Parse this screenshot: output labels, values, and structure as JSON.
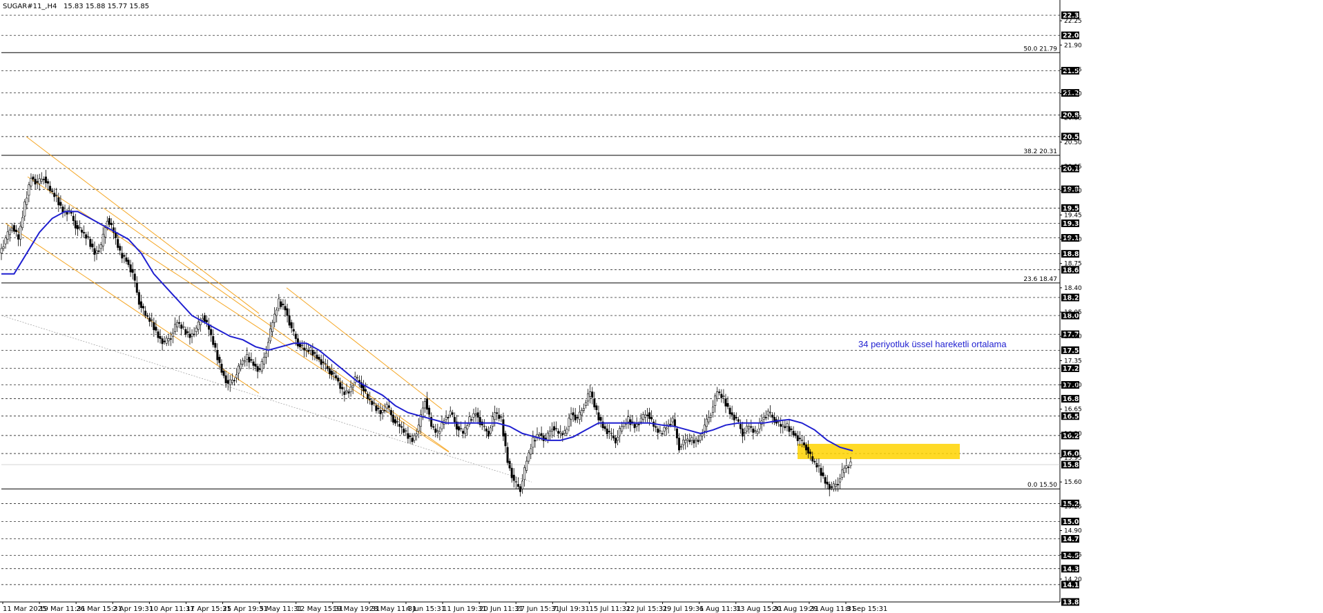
{
  "header": {
    "symbol": "SUGAR#11_,H4",
    "ohlc": "15.83 15.88 15.77 15.85"
  },
  "annotation": "34 periyotluk üssel hareketli ortalama",
  "colors": {
    "background": "#ffffff",
    "ema": "#1f1fd0",
    "channel": "#f5a623",
    "highlight_zone": "#ffd400",
    "level_line": "#000000",
    "price_badge": "#000000"
  },
  "chart_data": {
    "type": "candlestick",
    "title": "SUGAR#11_,H4",
    "ylim": [
      13.87,
      22.45
    ],
    "x_ticks": [
      "11 Mar 2025",
      "19 Mar 11:31",
      "26 Mar 15:31",
      "2 Apr 19:31",
      "10 Apr 11:31",
      "17 Apr 15:31",
      "25 Apr 19:31",
      "5 May 11:31",
      "12 May 15:31",
      "19 May 19:31",
      "28 May 11:31",
      "4 Jun 15:31",
      "11 Jun 19:31",
      "20 Jun 11:31",
      "27 Jun 15:31",
      "7 Jul 19:31",
      "15 Jul 11:31",
      "22 Jul 15:31",
      "29 Jul 19:31",
      "6 Aug 11:31",
      "13 Aug 15:31",
      "20 Aug 19:31",
      "29 Aug 11:31",
      "8 Sep 15:31"
    ],
    "dashed_levels": [
      22.33,
      22.04,
      21.53,
      21.21,
      20.89,
      20.58,
      20.12,
      19.82,
      19.55,
      19.33,
      19.12,
      18.89,
      18.66,
      18.26,
      18.0,
      17.73,
      17.5,
      17.24,
      17.0,
      16.8,
      16.55,
      16.27,
      16.01,
      15.29,
      15.03,
      14.78,
      14.54,
      14.35,
      14.12,
      13.87
    ],
    "axis_ticks": [
      22.25,
      21.9,
      21.55,
      21.2,
      20.85,
      20.5,
      20.15,
      19.8,
      19.45,
      19.1,
      18.75,
      18.4,
      18.05,
      17.7,
      17.35,
      17.0,
      16.65,
      16.3,
      15.95,
      15.6,
      15.25,
      14.9,
      14.55,
      14.2
    ],
    "fibonacci": [
      {
        "label": "50.0 21.79",
        "value": 21.79
      },
      {
        "label": "38.2 20.31",
        "value": 20.31
      },
      {
        "label": "23.6 18.47",
        "value": 18.47
      },
      {
        "label": "0.0 15.50",
        "value": 15.5
      }
    ],
    "current_price": 15.85,
    "highlight_zone": [
      15.93,
      16.15
    ],
    "ohlc_path": [
      [
        0,
        18.9
      ],
      [
        6,
        19.1
      ],
      [
        12,
        19.3
      ],
      [
        18,
        19.1
      ],
      [
        24,
        19.6
      ],
      [
        30,
        20.0
      ],
      [
        36,
        19.9
      ],
      [
        42,
        20.0
      ],
      [
        48,
        19.8
      ],
      [
        54,
        19.7
      ],
      [
        60,
        19.5
      ],
      [
        66,
        19.5
      ],
      [
        72,
        19.3
      ],
      [
        78,
        19.2
      ],
      [
        84,
        19.1
      ],
      [
        90,
        18.9
      ],
      [
        96,
        19.0
      ],
      [
        102,
        19.4
      ],
      [
        108,
        19.2
      ],
      [
        114,
        18.9
      ],
      [
        120,
        18.8
      ],
      [
        126,
        18.6
      ],
      [
        132,
        18.2
      ],
      [
        138,
        18.0
      ],
      [
        144,
        17.9
      ],
      [
        150,
        17.7
      ],
      [
        156,
        17.6
      ],
      [
        162,
        17.7
      ],
      [
        168,
        17.9
      ],
      [
        174,
        17.8
      ],
      [
        180,
        17.7
      ],
      [
        186,
        17.8
      ],
      [
        192,
        18.0
      ],
      [
        198,
        17.8
      ],
      [
        204,
        17.5
      ],
      [
        210,
        17.2
      ],
      [
        216,
        17.0
      ],
      [
        222,
        17.1
      ],
      [
        228,
        17.3
      ],
      [
        234,
        17.4
      ],
      [
        240,
        17.3
      ],
      [
        246,
        17.2
      ],
      [
        252,
        17.5
      ],
      [
        258,
        17.9
      ],
      [
        264,
        18.2
      ],
      [
        270,
        18.1
      ],
      [
        276,
        17.8
      ],
      [
        282,
        17.6
      ],
      [
        288,
        17.5
      ],
      [
        294,
        17.5
      ],
      [
        300,
        17.4
      ],
      [
        306,
        17.3
      ],
      [
        312,
        17.2
      ],
      [
        318,
        17.1
      ],
      [
        324,
        16.9
      ],
      [
        330,
        16.9
      ],
      [
        336,
        17.1
      ],
      [
        342,
        17.0
      ],
      [
        348,
        16.8
      ],
      [
        354,
        16.7
      ],
      [
        360,
        16.6
      ],
      [
        366,
        16.7
      ],
      [
        372,
        16.5
      ],
      [
        378,
        16.4
      ],
      [
        384,
        16.3
      ],
      [
        390,
        16.2
      ],
      [
        396,
        16.4
      ],
      [
        402,
        16.8
      ],
      [
        408,
        16.4
      ],
      [
        414,
        16.3
      ],
      [
        420,
        16.5
      ],
      [
        426,
        16.6
      ],
      [
        432,
        16.4
      ],
      [
        438,
        16.3
      ],
      [
        444,
        16.5
      ],
      [
        450,
        16.6
      ],
      [
        456,
        16.4
      ],
      [
        462,
        16.3
      ],
      [
        468,
        16.6
      ],
      [
        474,
        16.5
      ],
      [
        480,
        15.9
      ],
      [
        486,
        15.6
      ],
      [
        492,
        15.5
      ],
      [
        498,
        15.9
      ],
      [
        504,
        16.2
      ],
      [
        510,
        16.3
      ],
      [
        516,
        16.2
      ],
      [
        522,
        16.4
      ],
      [
        528,
        16.3
      ],
      [
        534,
        16.3
      ],
      [
        540,
        16.6
      ],
      [
        546,
        16.5
      ],
      [
        552,
        16.7
      ],
      [
        558,
        16.9
      ],
      [
        564,
        16.6
      ],
      [
        570,
        16.4
      ],
      [
        576,
        16.3
      ],
      [
        582,
        16.2
      ],
      [
        588,
        16.4
      ],
      [
        594,
        16.5
      ],
      [
        600,
        16.4
      ],
      [
        606,
        16.5
      ],
      [
        612,
        16.6
      ],
      [
        618,
        16.4
      ],
      [
        624,
        16.3
      ],
      [
        630,
        16.4
      ],
      [
        636,
        16.5
      ],
      [
        642,
        16.1
      ],
      [
        648,
        16.2
      ],
      [
        654,
        16.2
      ],
      [
        660,
        16.2
      ],
      [
        666,
        16.4
      ],
      [
        672,
        16.6
      ],
      [
        678,
        16.9
      ],
      [
        684,
        16.8
      ],
      [
        690,
        16.6
      ],
      [
        696,
        16.5
      ],
      [
        702,
        16.3
      ],
      [
        708,
        16.4
      ],
      [
        714,
        16.3
      ],
      [
        720,
        16.5
      ],
      [
        726,
        16.6
      ],
      [
        732,
        16.5
      ],
      [
        738,
        16.4
      ],
      [
        744,
        16.4
      ],
      [
        750,
        16.3
      ],
      [
        756,
        16.2
      ],
      [
        762,
        16.1
      ],
      [
        768,
        15.9
      ],
      [
        774,
        15.8
      ],
      [
        780,
        15.6
      ],
      [
        786,
        15.5
      ],
      [
        792,
        15.6
      ],
      [
        798,
        15.8
      ],
      [
        804,
        15.85
      ]
    ],
    "ema_path": [
      [
        0,
        18.6
      ],
      [
        12,
        18.6
      ],
      [
        24,
        18.9
      ],
      [
        36,
        19.2
      ],
      [
        48,
        19.4
      ],
      [
        60,
        19.5
      ],
      [
        72,
        19.5
      ],
      [
        84,
        19.4
      ],
      [
        96,
        19.3
      ],
      [
        108,
        19.2
      ],
      [
        120,
        19.1
      ],
      [
        132,
        18.9
      ],
      [
        144,
        18.6
      ],
      [
        156,
        18.4
      ],
      [
        168,
        18.2
      ],
      [
        180,
        18.0
      ],
      [
        192,
        17.9
      ],
      [
        204,
        17.8
      ],
      [
        216,
        17.7
      ],
      [
        228,
        17.65
      ],
      [
        240,
        17.55
      ],
      [
        252,
        17.5
      ],
      [
        264,
        17.55
      ],
      [
        276,
        17.6
      ],
      [
        288,
        17.6
      ],
      [
        300,
        17.5
      ],
      [
        312,
        17.35
      ],
      [
        324,
        17.2
      ],
      [
        336,
        17.05
      ],
      [
        348,
        16.95
      ],
      [
        360,
        16.85
      ],
      [
        372,
        16.7
      ],
      [
        384,
        16.6
      ],
      [
        396,
        16.55
      ],
      [
        408,
        16.5
      ],
      [
        420,
        16.45
      ],
      [
        432,
        16.45
      ],
      [
        444,
        16.45
      ],
      [
        456,
        16.45
      ],
      [
        468,
        16.45
      ],
      [
        480,
        16.4
      ],
      [
        492,
        16.3
      ],
      [
        504,
        16.25
      ],
      [
        516,
        16.2
      ],
      [
        528,
        16.2
      ],
      [
        540,
        16.25
      ],
      [
        552,
        16.35
      ],
      [
        564,
        16.45
      ],
      [
        576,
        16.45
      ],
      [
        588,
        16.45
      ],
      [
        600,
        16.45
      ],
      [
        612,
        16.45
      ],
      [
        624,
        16.42
      ],
      [
        636,
        16.4
      ],
      [
        648,
        16.35
      ],
      [
        660,
        16.3
      ],
      [
        672,
        16.35
      ],
      [
        684,
        16.42
      ],
      [
        696,
        16.45
      ],
      [
        708,
        16.45
      ],
      [
        720,
        16.45
      ],
      [
        732,
        16.48
      ],
      [
        744,
        16.5
      ],
      [
        756,
        16.45
      ],
      [
        768,
        16.35
      ],
      [
        780,
        16.2
      ],
      [
        792,
        16.1
      ],
      [
        804,
        16.05
      ]
    ]
  }
}
